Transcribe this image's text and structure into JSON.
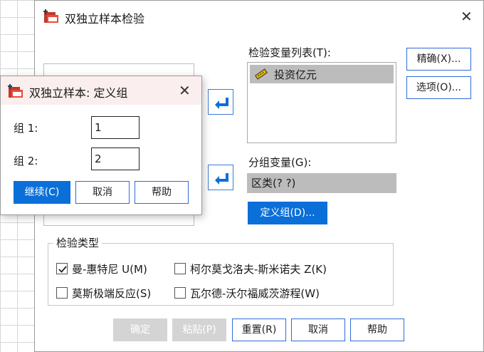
{
  "main_dialog": {
    "title": "双独立样本检验",
    "test_vars_label": "检验变量列表(T):",
    "test_vars": [
      "投资亿元"
    ],
    "group_var_label": "分组变量(G):",
    "group_var_value": "区类(? ?)",
    "define_groups_label": "定义组(D)...",
    "exact_label": "精确(X)...",
    "options_label": "选项(O)...",
    "test_type_label": "检验类型",
    "tests": [
      {
        "label": "曼-惠特尼 U(M)",
        "checked": true
      },
      {
        "label": "柯尔莫戈洛夫-斯米诺夫 Z(K)",
        "checked": false
      },
      {
        "label": "莫斯极端反应(S)",
        "checked": false
      },
      {
        "label": "瓦尔德-沃尔福威茨游程(W)",
        "checked": false
      }
    ],
    "buttons": {
      "ok": "确定",
      "paste": "粘贴(P)",
      "reset": "重置(R)",
      "cancel": "取消",
      "help": "帮助"
    }
  },
  "define_groups_dialog": {
    "title": "双独立样本: 定义组",
    "group1_label": "组 1:",
    "group1_value": "1",
    "group2_label": "组 2:",
    "group2_value": "2",
    "buttons": {
      "continue": "继续(C)",
      "cancel": "取消",
      "help": "帮助"
    }
  },
  "icons": {
    "close": "close-icon",
    "arrow": "arrow-left-icon",
    "ruler": "ruler-icon"
  },
  "colors": {
    "accent": "#0a6fd9",
    "selection": "#bcbcbc"
  }
}
